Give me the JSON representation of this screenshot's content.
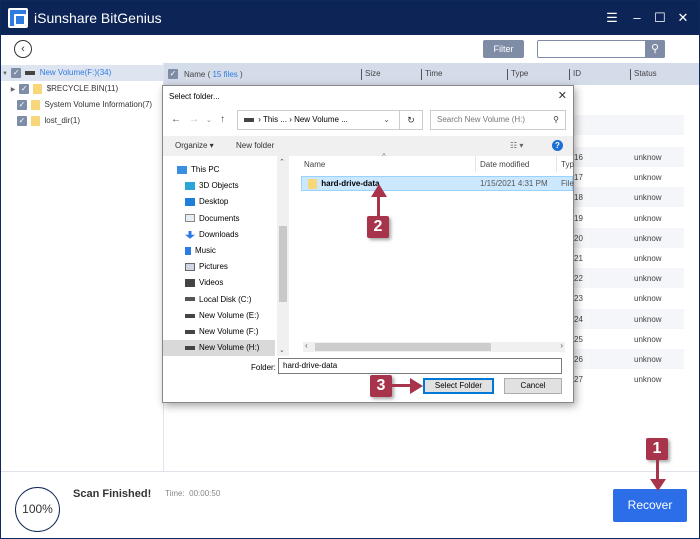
{
  "window": {
    "title": "iSunshare BitGenius",
    "controls": [
      "menu-icon",
      "minimize-icon",
      "maximize-icon",
      "close-icon"
    ]
  },
  "toolbar": {
    "filter_label": "Filter",
    "search_value": ""
  },
  "tree": {
    "root": {
      "label": "New Volume(F:)(34)",
      "checked": true,
      "expanded": true
    },
    "children": [
      {
        "label": "$RECYCLE.BIN(11)",
        "checked": true,
        "expandable": true
      },
      {
        "label": "System Volume Information(7)",
        "checked": true,
        "expandable": false
      },
      {
        "label": "lost_dir(1)",
        "checked": true,
        "expandable": false
      }
    ]
  },
  "grid": {
    "name_header_prefix": "Name ( ",
    "file_count": "15 files",
    "name_header_suffix": " )",
    "columns": [
      "Size",
      "Time",
      "Type",
      "ID",
      "Status"
    ],
    "rows": [
      {
        "id": "16",
        "status": "unknow"
      },
      {
        "id": "17",
        "status": "unknow"
      },
      {
        "id": "18",
        "status": "unknow"
      },
      {
        "id": "19",
        "status": "unknow"
      },
      {
        "id": "20",
        "status": "unknow"
      },
      {
        "id": "21",
        "status": "unknow"
      },
      {
        "id": "22",
        "status": "unknow"
      },
      {
        "id": "23",
        "status": "unknow"
      },
      {
        "id": "24",
        "status": "unknow"
      },
      {
        "id": "25",
        "status": "unknow"
      },
      {
        "id": "26",
        "status": "unknow"
      },
      {
        "id": "27",
        "status": "unknow"
      }
    ]
  },
  "bottom": {
    "progress": "100%",
    "status": "Scan Finished!",
    "time_label": "Time:",
    "time_value": "00:00:50",
    "recover_label": "Recover"
  },
  "dialog": {
    "title": "Select folder...",
    "address": "This ...  ›  New Volume ...",
    "search_placeholder": "Search New Volume (H:)",
    "organize_label": "Organize ▾",
    "new_folder_label": "New folder",
    "nav_items": [
      {
        "label": "This PC",
        "icon": "pc-icon"
      },
      {
        "label": "3D Objects",
        "icon": "cube-icon"
      },
      {
        "label": "Desktop",
        "icon": "desktop-icon"
      },
      {
        "label": "Documents",
        "icon": "document-icon"
      },
      {
        "label": "Downloads",
        "icon": "download-icon"
      },
      {
        "label": "Music",
        "icon": "music-icon"
      },
      {
        "label": "Pictures",
        "icon": "pictures-icon"
      },
      {
        "label": "Videos",
        "icon": "videos-icon"
      },
      {
        "label": "Local Disk (C:)",
        "icon": "disk-icon"
      },
      {
        "label": "New Volume (E:)",
        "icon": "drive-icon"
      },
      {
        "label": "New Volume (F:)",
        "icon": "drive-icon"
      },
      {
        "label": "New Volume (H:)",
        "icon": "drive-icon",
        "selected": true
      }
    ],
    "list_headers": [
      "Name",
      "Date modified",
      "Typ"
    ],
    "items": [
      {
        "name": "hard-drive-data",
        "date": "1/15/2021 4:31 PM",
        "type": "File",
        "selected": true
      }
    ],
    "folder_label": "Folder:",
    "folder_value": "hard-drive-data",
    "select_label": "Select Folder",
    "cancel_label": "Cancel"
  },
  "annotations": [
    "1",
    "2",
    "3"
  ],
  "colors": {
    "titlebar": "#0d2457",
    "accent": "#2b6ee8",
    "annotation": "#a8344c",
    "grid_header": "#d4dbe9"
  }
}
